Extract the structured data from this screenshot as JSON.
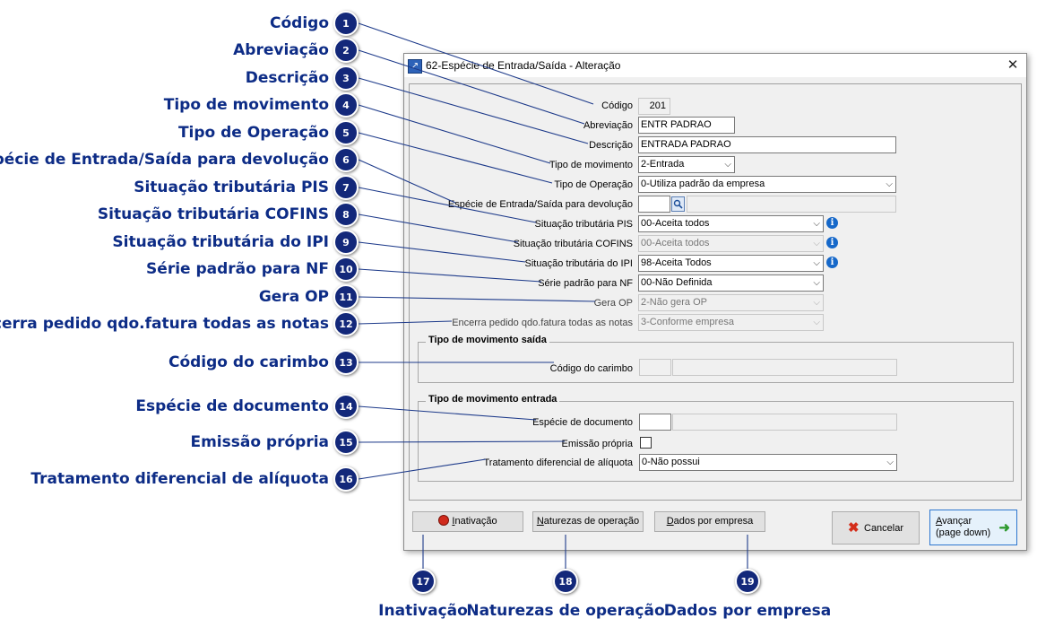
{
  "callouts": [
    {
      "num": "1",
      "text": "Código"
    },
    {
      "num": "2",
      "text": "Abreviação"
    },
    {
      "num": "3",
      "text": "Descrição"
    },
    {
      "num": "4",
      "text": "Tipo de movimento"
    },
    {
      "num": "5",
      "text": "Tipo de Operação"
    },
    {
      "num": "6",
      "text": "Espécie de Entrada/Saída para devolução"
    },
    {
      "num": "7",
      "text": "Situação tributária PIS"
    },
    {
      "num": "8",
      "text": "Situação tributária COFINS"
    },
    {
      "num": "9",
      "text": "Situação tributária do IPI"
    },
    {
      "num": "10",
      "text": "Série padrão para NF"
    },
    {
      "num": "11",
      "text": "Gera OP"
    },
    {
      "num": "12",
      "text": "Encerra pedido qdo.fatura todas as notas"
    },
    {
      "num": "13",
      "text": "Código do carimbo"
    },
    {
      "num": "14",
      "text": "Espécie de documento"
    },
    {
      "num": "15",
      "text": "Emissão própria"
    },
    {
      "num": "16",
      "text": "Tratamento diferencial de alíquota"
    },
    {
      "num": "17",
      "text": "Inativação"
    },
    {
      "num": "18",
      "text": "Naturezas de operação"
    },
    {
      "num": "19",
      "text": "Dados por empresa"
    }
  ],
  "window": {
    "title": "62-Espécie de Entrada/Saída - Alteração",
    "close": "✕"
  },
  "form": {
    "codigo": {
      "label": "Código",
      "value": "201"
    },
    "abreviacao": {
      "label": "Abreviação",
      "value": "ENTR PADRAO"
    },
    "descricao": {
      "label": "Descrição",
      "value": "ENTRADA PADRAO"
    },
    "tipo_movimento": {
      "label": "Tipo de movimento",
      "value": "2-Entrada"
    },
    "tipo_operacao": {
      "label": "Tipo de Operação",
      "value": "0-Utiliza padrão da empresa"
    },
    "especie_devolucao": {
      "label": "Espécie de Entrada/Saída para devolução",
      "value": "",
      "description": ""
    },
    "sit_pis": {
      "label": "Situação tributária PIS",
      "value": "00-Aceita todos"
    },
    "sit_cofins": {
      "label": "Situação tributária COFINS",
      "value": "00-Aceita todos"
    },
    "sit_ipi": {
      "label": "Situação tributária do IPI",
      "value": "98-Aceita Todos"
    },
    "serie_nf": {
      "label": "Série padrão para NF",
      "value": "00-Não Definida"
    },
    "gera_op": {
      "label": "Gera OP",
      "value": "2-Não gera OP"
    },
    "encerra_pedido": {
      "label": "Encerra pedido qdo.fatura todas as notas",
      "value": "3-Conforme empresa"
    },
    "group_saida": {
      "title": "Tipo de movimento saída",
      "codigo_carimbo": {
        "label": "Código do carimbo",
        "value": "",
        "description": ""
      }
    },
    "group_entrada": {
      "title": "Tipo de movimento entrada",
      "especie_documento": {
        "label": "Espécie de documento",
        "value": "",
        "description": ""
      },
      "emissao_propria": {
        "label": "Emissão própria",
        "checked": false
      },
      "tratamento_aliquota": {
        "label": "Tratamento diferencial de alíquota",
        "value": "0-Não possui"
      }
    }
  },
  "buttons": {
    "inativacao": {
      "label_prefix": "",
      "label_u": "I",
      "label_rest": "nativação"
    },
    "naturezas": {
      "label_u": "N",
      "label_rest": "aturezas de operação"
    },
    "dados_empresa": {
      "label_u": "D",
      "label_rest": "ados por empresa"
    },
    "cancelar": {
      "label": "Cancelar"
    },
    "avancar": {
      "line1_u": "A",
      "line1_rest": "vançar",
      "line2": "(page down)"
    }
  },
  "colors": {
    "callout_text": "#0d2c86",
    "badge": "#13287a",
    "info_icon": "#1668c9"
  },
  "icons": [
    "info-icon",
    "lookup-icon",
    "inativacao-icon",
    "cancel-x-icon",
    "arrow-right-icon",
    "window-app-icon",
    "close-icon",
    "chevron-down-icon"
  ]
}
